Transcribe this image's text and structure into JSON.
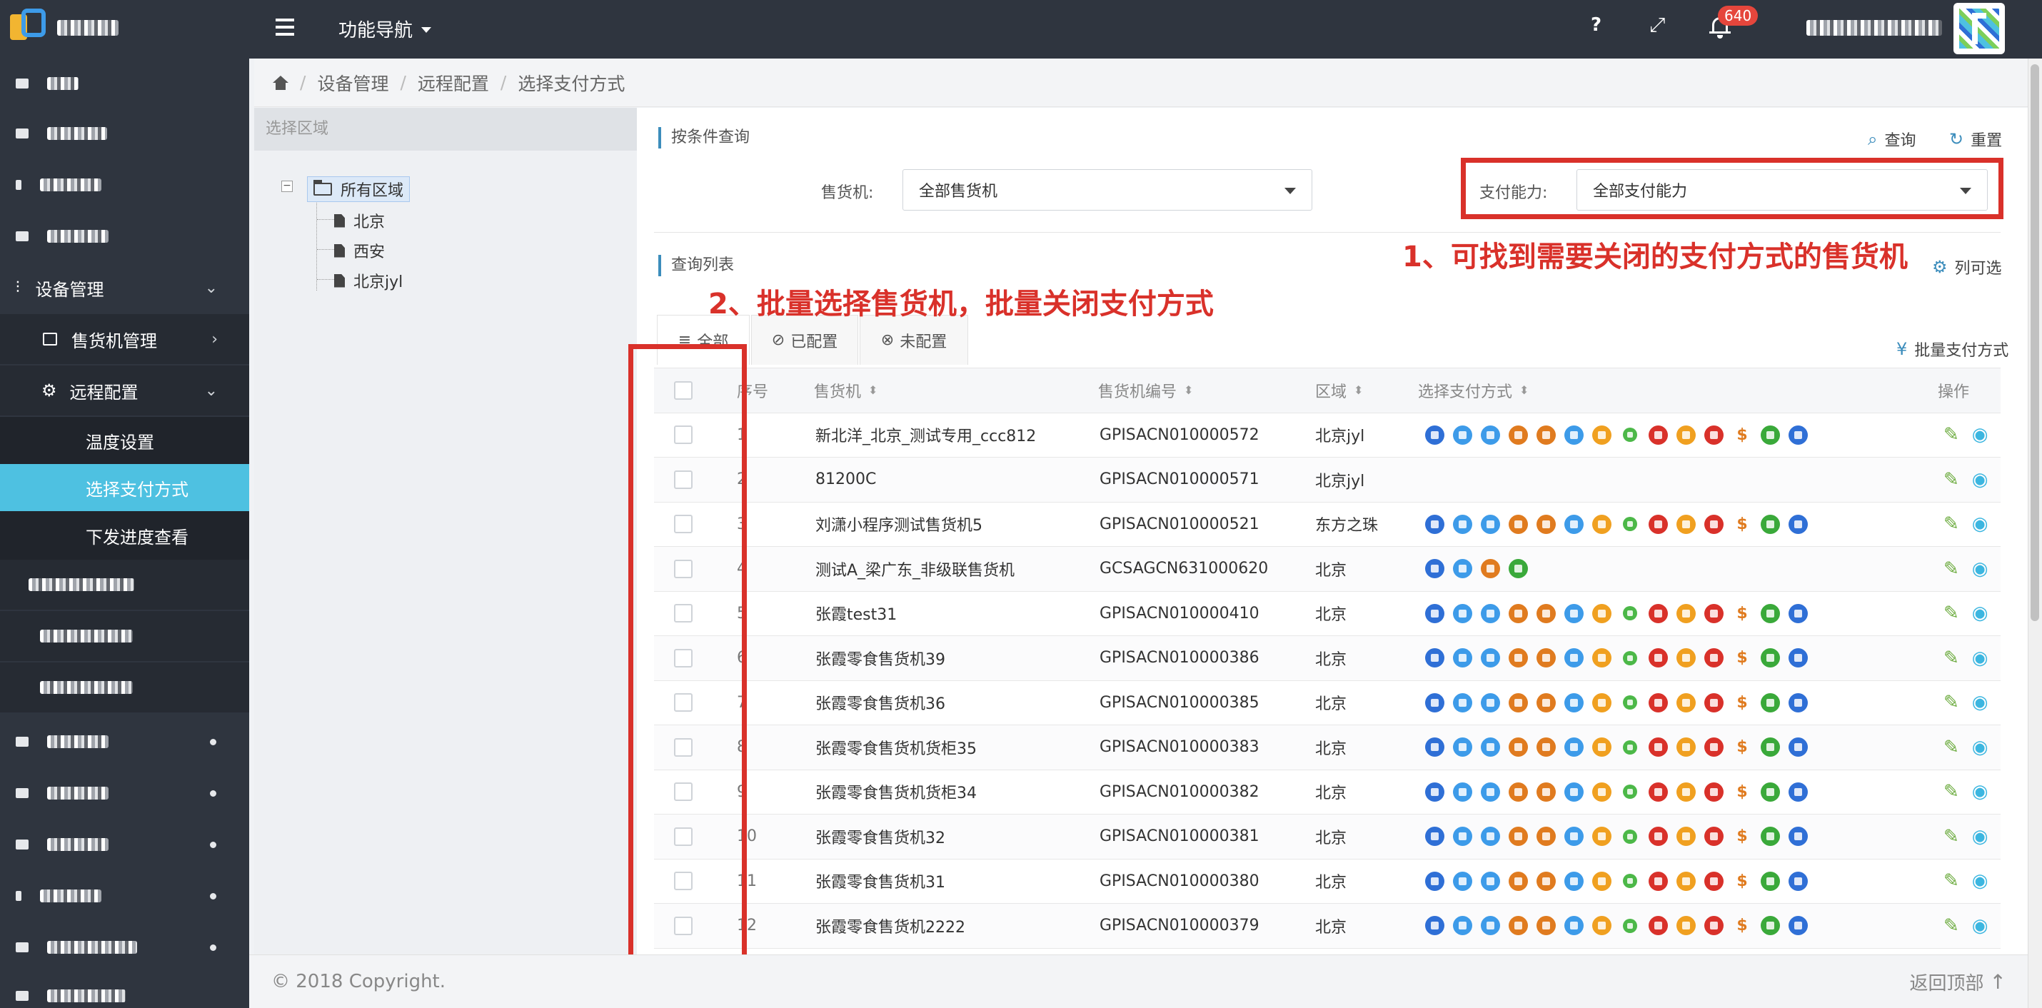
{
  "topbar": {
    "nav_label": "功能导航",
    "help_icon": "question-icon",
    "notification_count": "640"
  },
  "sidebar": {
    "device_mgmt": "设备管理",
    "vending_mgmt": "售货机管理",
    "remote_config": "远程配置",
    "temp_settings": "温度设置",
    "select_payment": "选择支付方式",
    "dispatch_progress": "下发进度查看"
  },
  "breadcrumb": [
    "设备管理",
    "远程配置",
    "选择支付方式"
  ],
  "region": {
    "header": "选择区域",
    "root": "所有区域",
    "children": [
      "北京",
      "西安",
      "北京jyl"
    ]
  },
  "query": {
    "section_title": "按条件查询",
    "search_label": "查询",
    "reset_label": "重置",
    "machine_label": "售货机:",
    "machine_value": "全部售货机",
    "payment_label": "支付能力:",
    "payment_value": "全部支付能力"
  },
  "list": {
    "section_title": "查询列表",
    "column_select_label": "列可选",
    "batch_label": "批量支付方式",
    "tabs": [
      "全部",
      "已配置",
      "未配置"
    ],
    "columns": {
      "index": "序号",
      "machine": "售货机",
      "code": "售货机编号",
      "region": "区域",
      "payments": "选择支付方式",
      "ops": "操作"
    },
    "rows": [
      {
        "index": "1",
        "name": "新北洋_北京_测试专用_ccc812",
        "code": "GPISACN010000572",
        "region": "北京jyl",
        "pay": "full"
      },
      {
        "index": "2",
        "name": "81200C",
        "code": "GPISACN010000571",
        "region": "北京jyl",
        "pay": "none"
      },
      {
        "index": "3",
        "name": "刘潇小程序测试售货机5",
        "code": "GPISACN010000521",
        "region": "东方之珠",
        "pay": "full"
      },
      {
        "index": "4",
        "name": "测试A_梁广东_非级联售货机",
        "code": "GCSAGCN631000620",
        "region": "北京",
        "pay": "short"
      },
      {
        "index": "5",
        "name": "张霞test31",
        "code": "GPISACN010000410",
        "region": "北京",
        "pay": "full"
      },
      {
        "index": "6",
        "name": "张霞零食售货机39",
        "code": "GPISACN010000386",
        "region": "北京",
        "pay": "full"
      },
      {
        "index": "7",
        "name": "张霞零食售货机36",
        "code": "GPISACN010000385",
        "region": "北京",
        "pay": "full"
      },
      {
        "index": "8",
        "name": "张霞零食售货机货柜35",
        "code": "GPISACN010000383",
        "region": "北京",
        "pay": "full"
      },
      {
        "index": "9",
        "name": "张霞零食售货机货柜34",
        "code": "GPISACN010000382",
        "region": "北京",
        "pay": "full"
      },
      {
        "index": "10",
        "name": "张霞零食售货机32",
        "code": "GPISACN010000381",
        "region": "北京",
        "pay": "full"
      },
      {
        "index": "11",
        "name": "张霞零食售货机31",
        "code": "GPISACN010000380",
        "region": "北京",
        "pay": "full"
      },
      {
        "index": "12",
        "name": "张霞零食售货机2222",
        "code": "GPISACN010000379",
        "region": "北京",
        "pay": "full"
      }
    ]
  },
  "annotations": {
    "note1": "1、可找到需要关闭的支付方式的售货机",
    "note2": "2、批量选择售货机，批量关闭支付方式",
    "color": "#d9312a"
  },
  "payment_icon_colors": [
    "#2f6fd6",
    "#3d9be9",
    "#3d9be9",
    "#e07b1f",
    "#e07b1f",
    "#3d9be9",
    "#f0a020",
    "#4cb848",
    "#d9312a",
    "#f0a020",
    "#d9312a",
    "#e07b1f",
    "#3aa93a",
    "#2f6fd6"
  ],
  "footer": {
    "copyright": "© 2018 Copyright.",
    "back_top": "返回顶部"
  },
  "colors": {
    "sidebar_bg": "#2f353f",
    "active": "#4ec1e1",
    "accent": "#3c8dbc",
    "badge": "#e5463c"
  }
}
